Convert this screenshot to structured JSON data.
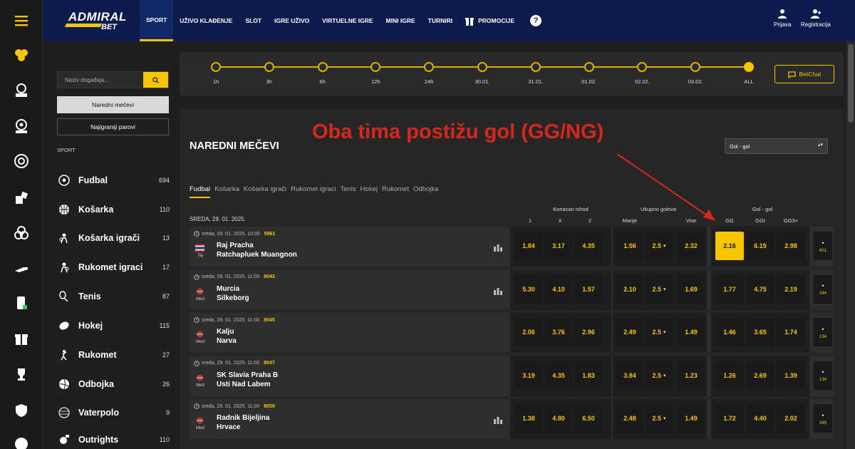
{
  "brand": {
    "name": "ADMIRAL",
    "sub": "BET",
    "accent": "#f7c600",
    "header_bg": "#0d1b4d"
  },
  "nav": [
    {
      "label": "SPORT",
      "active": true
    },
    {
      "label": "UŽIVO KLAĐENJE"
    },
    {
      "label": "SLOT"
    },
    {
      "label": "IGRE UŽIVO"
    },
    {
      "label": "VIRTUELNE IGRE"
    },
    {
      "label": "MINI IGRE"
    },
    {
      "label": "TURNIRI"
    },
    {
      "label": "PROMOCIJE"
    }
  ],
  "header_right": {
    "login": "Prijava",
    "register": "Registracija"
  },
  "sidebar": {
    "search_placeholder": "Naziv događaja...",
    "btn_upcoming": "Naredni mečevi",
    "btn_most_played": "Najigraniji parovi",
    "section_label": "SPORT",
    "sports": [
      {
        "name": "Fudbal",
        "count": "694",
        "icon": "soccer-ball-icon"
      },
      {
        "name": "Košarka",
        "count": "110",
        "icon": "basketball-icon"
      },
      {
        "name": "Košarka igrači",
        "count": "13",
        "icon": "basketball-player-icon"
      },
      {
        "name": "Rukomet igraci",
        "count": "17",
        "icon": "handball-player-icon"
      },
      {
        "name": "Tenis",
        "count": "87",
        "icon": "tennis-icon"
      },
      {
        "name": "Hokej",
        "count": "115",
        "icon": "hockey-puck-icon"
      },
      {
        "name": "Rukomet",
        "count": "27",
        "icon": "handball-icon"
      },
      {
        "name": "Odbojka",
        "count": "26",
        "icon": "volleyball-icon"
      },
      {
        "name": "Vaterpolo",
        "count": "9",
        "icon": "waterpolo-icon"
      },
      {
        "name": "Outrights",
        "count": "110",
        "icon": "outrights-icon"
      }
    ]
  },
  "timeline": {
    "points": [
      "1h",
      "3h",
      "6h",
      "12h",
      "24h",
      "30.01.",
      "31.01.",
      "01.02.",
      "02.02.",
      "03.02.",
      "ALL"
    ],
    "selected": "ALL",
    "chat_label": "BetChat"
  },
  "main": {
    "title": "NAREDNI MEČEVI",
    "annotation": "Oba tima postižu gol (GG/NG)",
    "market_select": "Gol - gol",
    "tabs": [
      "Fudbal",
      "Košarka",
      "Košarka igrači",
      "Rukomet igraci",
      "Tenis",
      "Hokej",
      "Rukomet",
      "Odbojka"
    ],
    "date_header": "SREDA, 29. 01. 2025.",
    "groups": {
      "g1": "Konacan ishod",
      "g2": "Ukupno golova",
      "g3": "Gol - gol"
    },
    "subcols": {
      "c1": "1",
      "cx": "X",
      "c2": "2",
      "under": "Manje",
      "over": "Vise",
      "gg": "GG",
      "ggi": "GGI",
      "gg3": "GG3+"
    },
    "matches": [
      {
        "meta": "sreda, 29. 01. 2025. 10:00",
        "id": "5961",
        "cc": "Taj",
        "home": "Raj Pracha",
        "away": "Ratchapluek Muangnon",
        "stats": true,
        "odds": [
          "1.84",
          "3.17",
          "4.35"
        ],
        "under": "1.56",
        "line": "2.5",
        "over": "2.32",
        "gg": [
          "2.16",
          "6.15",
          "2.98"
        ],
        "more": "601"
      },
      {
        "meta": "sreda, 29. 01. 2025. 11:00",
        "id": "8043",
        "cc": "Med",
        "home": "Murcia",
        "away": "Silkeborg",
        "stats": true,
        "odds": [
          "5.30",
          "4.10",
          "1.57"
        ],
        "under": "2.10",
        "line": "2.5",
        "over": "1.69",
        "gg": [
          "1.77",
          "4.75",
          "2.19"
        ],
        "more": "344"
      },
      {
        "meta": "sreda, 29. 01. 2025. 11:00",
        "id": "8045",
        "cc": "Med",
        "home": "Kalju",
        "away": "Narva",
        "stats": false,
        "odds": [
          "2.06",
          "3.76",
          "2.96"
        ],
        "under": "2.49",
        "line": "2.5",
        "over": "1.49",
        "gg": [
          "1.46",
          "3.65",
          "1.74"
        ],
        "more": "134"
      },
      {
        "meta": "sreda, 29. 01. 2025. 11:00",
        "id": "8047",
        "cc": "Med",
        "home": "SK Slavia Praha B",
        "away": "Usti Nad Labem",
        "stats": false,
        "odds": [
          "3.19",
          "4.35",
          "1.83"
        ],
        "under": "3.84",
        "line": "2.5",
        "over": "1.23",
        "gg": [
          "1.26",
          "2.69",
          "1.39"
        ],
        "more": "134"
      },
      {
        "meta": "sreda, 29. 01. 2025. 11:00",
        "id": "8059",
        "cc": "Med",
        "home": "Radnik Bijeljina",
        "away": "Hrvace",
        "stats": true,
        "odds": [
          "1.38",
          "4.80",
          "6.50"
        ],
        "under": "2.48",
        "line": "2.5",
        "over": "1.49",
        "gg": [
          "1.72",
          "4.40",
          "2.02"
        ],
        "more": "345"
      }
    ]
  }
}
